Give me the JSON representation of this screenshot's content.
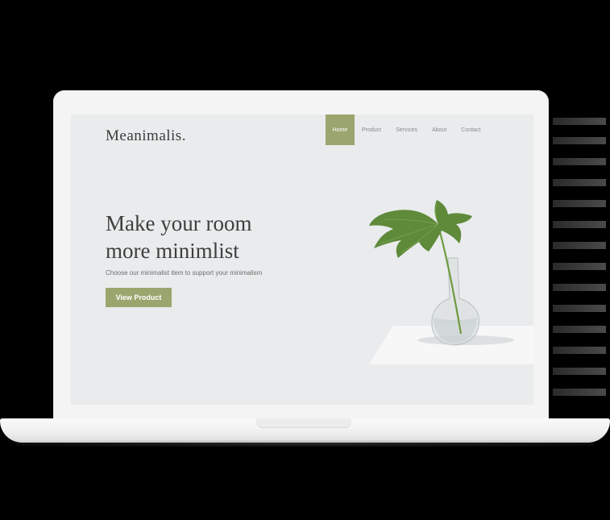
{
  "site": {
    "logo": "Meanimalis.",
    "nav": [
      {
        "label": "Home",
        "active": true
      },
      {
        "label": "Product",
        "active": false
      },
      {
        "label": "Services",
        "active": false
      },
      {
        "label": "About",
        "active": false
      },
      {
        "label": "Contact",
        "active": false
      }
    ],
    "hero": {
      "headline_line1": "Make your room",
      "headline_line2": "more minimlist",
      "subtext": "Choose our minimalist item to support your minimalism",
      "cta_label": "View Product"
    }
  },
  "colors": {
    "accent": "#9ba56e",
    "screen_bg": "#e9ebec",
    "text_dark": "#3e3e3e",
    "leaf": "#5e8a3a"
  },
  "icons": {
    "hero_image": "plant-in-vase-image"
  }
}
